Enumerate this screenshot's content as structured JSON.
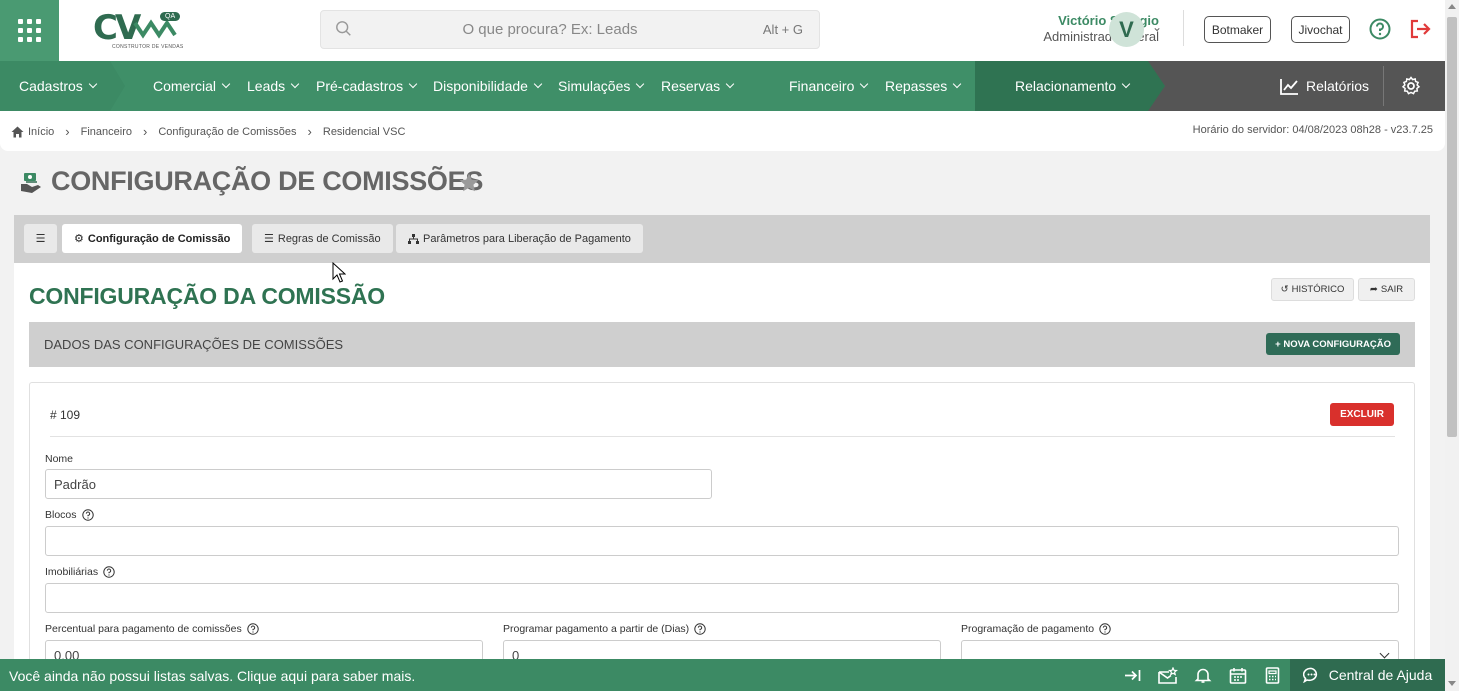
{
  "header": {
    "logo_text": "CV",
    "logo_badge": "QA",
    "logo_subtitle": "CONSTRUTOR DE VENDAS",
    "search_placeholder": "O que procura? Ex: Leads",
    "search_shortcut": "Alt + G",
    "user_name": "Victório Sbrogio",
    "user_role": "Administrador Geral",
    "avatar_initial": "V",
    "botmaker_label": "Botmaker",
    "jivochat_label": "Jivochat"
  },
  "nav": {
    "items": [
      {
        "label": "Cadastros"
      },
      {
        "label": "Comercial"
      },
      {
        "label": "Leads"
      },
      {
        "label": "Pré-cadastros"
      },
      {
        "label": "Disponibilidade"
      },
      {
        "label": "Simulações"
      },
      {
        "label": "Reservas"
      },
      {
        "label": "Financeiro"
      },
      {
        "label": "Repasses"
      },
      {
        "label": "Relacionamento"
      }
    ],
    "reports_label": "Relatórios"
  },
  "breadcrumb": {
    "items": [
      "Início",
      "Financeiro",
      "Configuração de Comissões",
      "Residencial VSC"
    ],
    "server_time": "Horário do servidor: 04/08/2023 08h28 - v23.7.25"
  },
  "page": {
    "title": "CONFIGURAÇÃO DE COMISSÕES"
  },
  "tabs": [
    {
      "label": "Configuração de Comissão",
      "icon": "gear-icon",
      "active": true
    },
    {
      "label": "Regras de Comissão",
      "icon": "list-icon",
      "active": false
    },
    {
      "label": "Parâmetros para Liberação de Pagamento",
      "icon": "sitemap-icon",
      "active": false
    }
  ],
  "section": {
    "title": "CONFIGURAÇÃO DA COMISSÃO",
    "history_label": "HISTÓRICO",
    "exit_label": "SAIR",
    "subheader": "DADOS DAS CONFIGURAÇÕES DE COMISSÕES",
    "new_config_label": "+ NOVA CONFIGURAÇÃO"
  },
  "config": {
    "id_label": "# 109",
    "delete_label": "EXCLUIR",
    "fields": {
      "nome_label": "Nome",
      "nome_value": "Padrão",
      "blocos_label": "Blocos",
      "blocos_value": "",
      "imobiliarias_label": "Imobiliárias",
      "imobiliarias_value": "",
      "percentual_label": "Percentual para pagamento de comissões",
      "percentual_value": "0,00",
      "programar_label": "Programar pagamento a partir de (Dias)",
      "programar_value": "0",
      "programacao_label": "Programação de pagamento",
      "programacao_value": ""
    }
  },
  "footer": {
    "message": "Você ainda não possui listas salvas. Clique aqui para saber mais.",
    "help_center_label": "Central de Ajuda"
  },
  "colors": {
    "brand_green": "#3c8a64",
    "dark_green": "#2f6b50",
    "danger": "#d9302c"
  }
}
